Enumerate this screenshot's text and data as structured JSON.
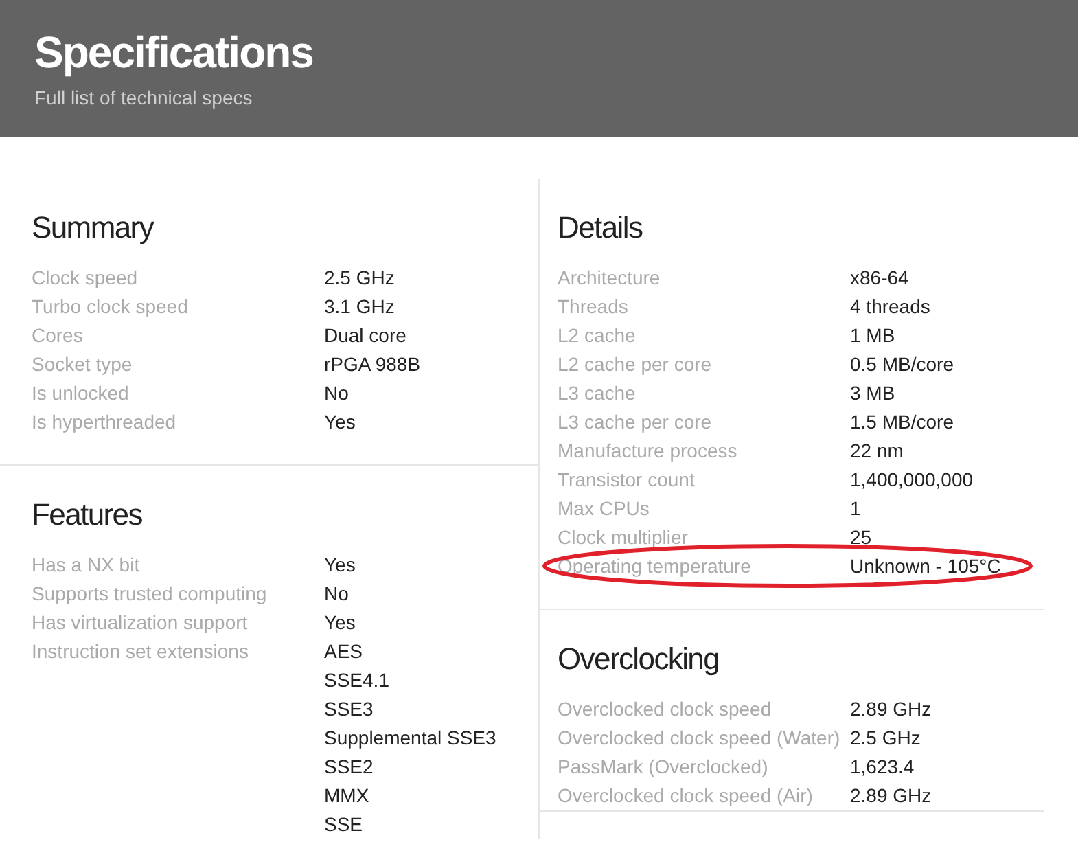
{
  "header": {
    "title": "Specifications",
    "subtitle": "Full list of technical specs"
  },
  "left": [
    {
      "heading": "Summary",
      "rows": [
        {
          "label": "Clock speed",
          "value": "2.5 GHz",
          "highlighted": false
        },
        {
          "label": "Turbo clock speed",
          "value": "3.1 GHz",
          "highlighted": false
        },
        {
          "label": "Cores",
          "value": "Dual core",
          "highlighted": false
        },
        {
          "label": "Socket type",
          "value": "rPGA 988B",
          "highlighted": false
        },
        {
          "label": "Is unlocked",
          "value": "No",
          "highlighted": false
        },
        {
          "label": "Is hyperthreaded",
          "value": "Yes",
          "highlighted": false
        }
      ]
    },
    {
      "heading": "Features",
      "rows": [
        {
          "label": "Has a NX bit",
          "value": "Yes",
          "highlighted": false
        },
        {
          "label": "Supports trusted computing",
          "value": "No",
          "highlighted": false
        },
        {
          "label": "Has virtualization support",
          "value": "Yes",
          "highlighted": false
        },
        {
          "label": "Instruction set extensions",
          "values": [
            "AES",
            "SSE4.1",
            "SSE3",
            "Supplemental SSE3",
            "SSE2",
            "MMX",
            "SSE"
          ],
          "highlighted": false
        }
      ]
    }
  ],
  "right": [
    {
      "heading": "Details",
      "rows": [
        {
          "label": "Architecture",
          "value": "x86-64",
          "highlighted": false
        },
        {
          "label": "Threads",
          "value": "4 threads",
          "highlighted": false
        },
        {
          "label": "L2 cache",
          "value": "1 MB",
          "highlighted": false
        },
        {
          "label": "L2 cache per core",
          "value": "0.5 MB/core",
          "highlighted": false
        },
        {
          "label": "L3 cache",
          "value": "3 MB",
          "highlighted": false
        },
        {
          "label": "L3 cache per core",
          "value": "1.5 MB/core",
          "highlighted": false
        },
        {
          "label": "Manufacture process",
          "value": "22 nm",
          "highlighted": false
        },
        {
          "label": "Transistor count",
          "value": "1,400,000,000",
          "highlighted": false
        },
        {
          "label": "Max CPUs",
          "value": "1",
          "highlighted": false
        },
        {
          "label": "Clock multiplier",
          "value": "25",
          "highlighted": false
        },
        {
          "label": "Operating temperature",
          "value": "Unknown - 105°C",
          "highlighted": true
        }
      ]
    },
    {
      "heading": "Overclocking",
      "rows": [
        {
          "label": "Overclocked clock speed",
          "value": "2.89 GHz",
          "highlighted": false
        },
        {
          "label": "Overclocked clock speed (Water)",
          "value": "2.5 GHz",
          "highlighted": false
        },
        {
          "label": "PassMark (Overclocked)",
          "value": "1,623.4",
          "highlighted": false
        },
        {
          "label": "Overclocked clock speed (Air)",
          "value": "2.89 GHz",
          "highlighted": false
        }
      ]
    }
  ]
}
